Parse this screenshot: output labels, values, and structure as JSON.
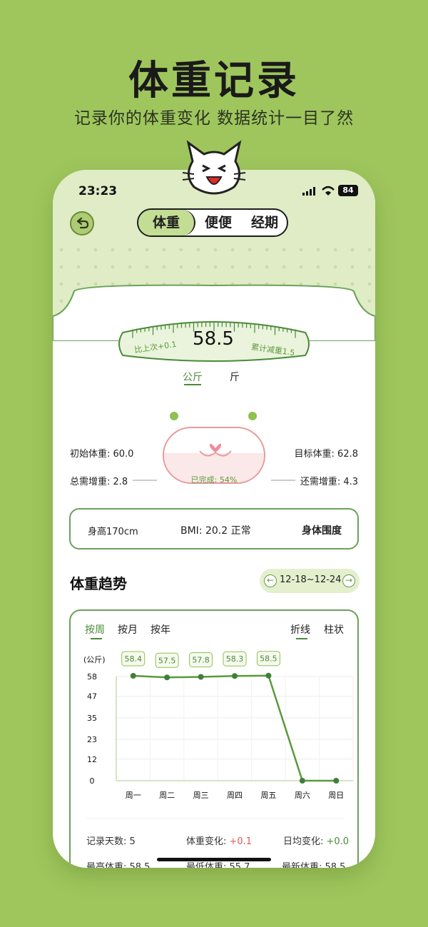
{
  "promo": {
    "title": "体重记录",
    "subtitle": "记录你的体重变化  数据统计一目了然"
  },
  "status_bar": {
    "time": "23:23",
    "battery": "84"
  },
  "segment": {
    "items": [
      "体重",
      "便便",
      "经期"
    ],
    "active": "体重"
  },
  "scale": {
    "weight": "58.5",
    "vs_last": "比上次+0.1",
    "total_lost": "累计减重1.5"
  },
  "units": {
    "kg": "公斤",
    "jin": "斤",
    "active": "公斤"
  },
  "progress": {
    "initial": "初始体重: 60.0",
    "target": "目标体重: 62.8",
    "total_gain": "总需增重: 2.8",
    "remaining": "还需增重: 4.3",
    "done_label": "已完成: 54%",
    "percent": 54
  },
  "body_info": {
    "height": "身高170cm",
    "bmi": "BMI: 20.2 正常",
    "measure": "身体围度"
  },
  "trend": {
    "title": "体重趋势",
    "date_range": "12-18~12-24",
    "tabs": [
      "按周",
      "按月",
      "按年"
    ],
    "active_tab": "按周",
    "chart_types": [
      "折线",
      "柱状"
    ],
    "active_chart": "折线"
  },
  "chart_data": {
    "type": "line",
    "ylabel": "(公斤)",
    "yticks": [
      "58",
      "47",
      "35",
      "23",
      "12",
      "0"
    ],
    "ylim": [
      0,
      58
    ],
    "categories": [
      "周一",
      "周二",
      "周三",
      "周四",
      "周五",
      "周六",
      "周日"
    ],
    "values": [
      58.4,
      57.5,
      57.8,
      58.3,
      58.5,
      0,
      0
    ],
    "data_labels": [
      "58.4",
      "57.5",
      "57.8",
      "58.3",
      "58.5"
    ],
    "grid": true
  },
  "summary": {
    "days": "记录天数: 5",
    "change_label": "体重变化: ",
    "change_val": "+0.1",
    "daily_label": "日均变化: ",
    "daily_val": "+0.0",
    "max": "最高体重: 58.5",
    "min": "最低体重: 55.7",
    "latest": "最新体重: 58.5"
  },
  "colors": {
    "bg": "#9fc65d",
    "accent": "#4a8a3a",
    "pink": "#e79a9a",
    "red": "#e25858"
  }
}
